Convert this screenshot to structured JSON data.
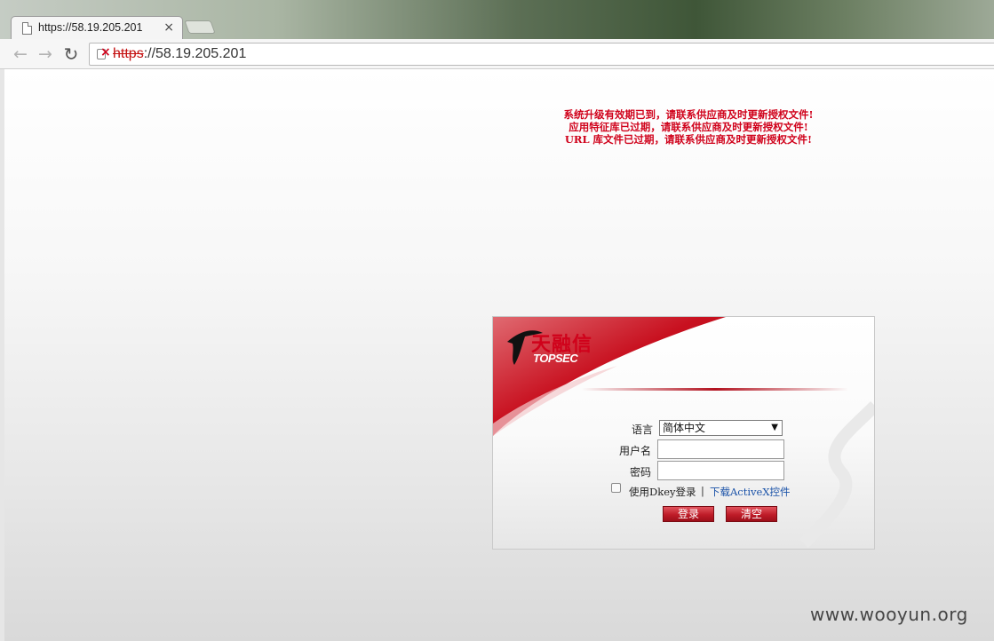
{
  "browser": {
    "tab_title": "https://58.19.205.201",
    "tab_close": "×",
    "url_scheme": "https",
    "url_rest": "://58.19.205.201",
    "nav": {
      "back": "←",
      "forward": "→",
      "reload": "↻"
    }
  },
  "page": {
    "warnings": [
      "系统升级有效期已到，请联系供应商及时更新授权文件!",
      "应用特征库已过期，请联系供应商及时更新授权文件!",
      "URL 库文件已过期，请联系供应商及时更新授权文件!"
    ]
  },
  "login": {
    "brand_cn": "天融信",
    "brand_en": "TOPSEC",
    "language_label": "语言",
    "language_value": "简体中文",
    "username_label": "用户名",
    "username_value": "",
    "password_label": "密码",
    "password_value": "",
    "dkey_label": "使用Dkey登录",
    "separator": "|",
    "activex_link": "下载ActiveX控件",
    "login_button": "登录",
    "clear_button": "清空"
  },
  "watermark": "www.wooyun.org",
  "colors": {
    "warning": "#d0021b",
    "brand": "#c8101f",
    "link": "#1a52a8"
  }
}
